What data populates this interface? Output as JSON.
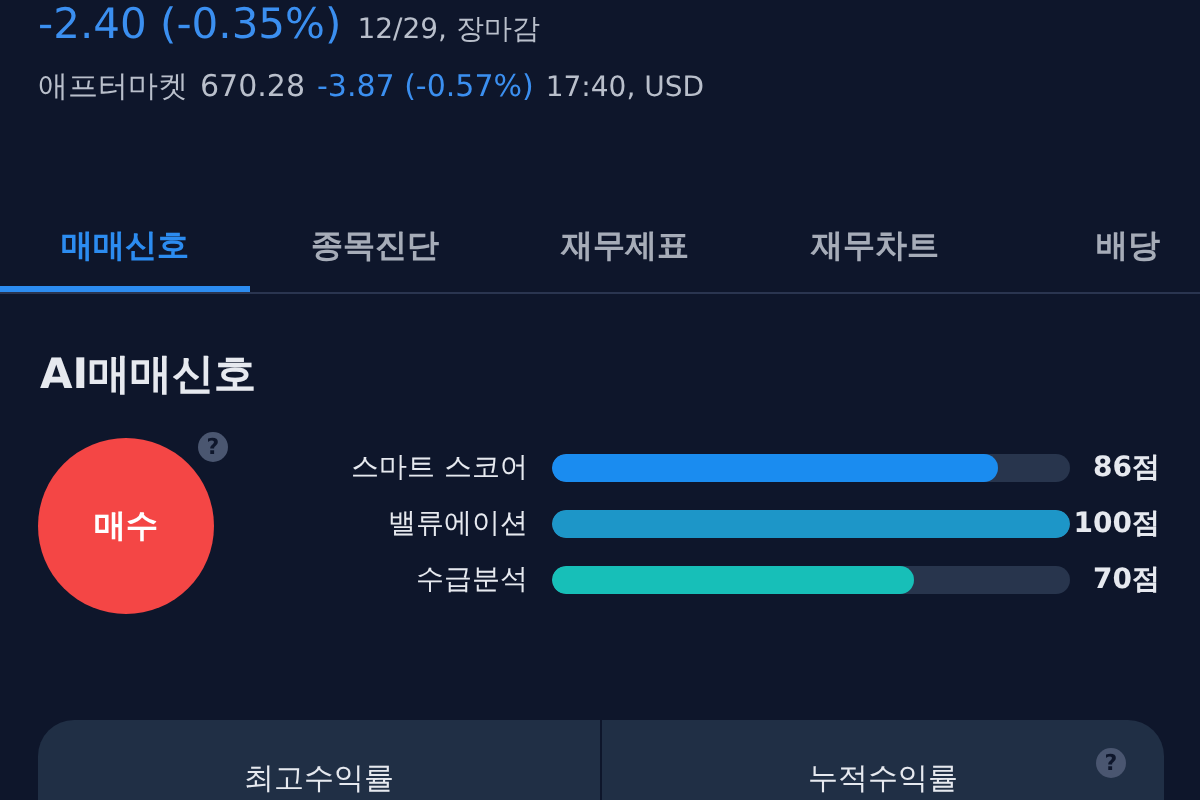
{
  "quote": {
    "change": "-2.40 (-0.35%)",
    "time": "12/29, 장마감"
  },
  "after_market": {
    "label": "애프터마켓",
    "price": "670.28",
    "change": "-3.87 (-0.57%)",
    "time": "17:40, USD"
  },
  "tabs": [
    {
      "label": "매매신호",
      "selected": true
    },
    {
      "label": "종목진단",
      "selected": false
    },
    {
      "label": "재무제표",
      "selected": false
    },
    {
      "label": "재무차트",
      "selected": false
    },
    {
      "label": "배당",
      "selected": false
    }
  ],
  "section_title": "AI매매신호",
  "signal": {
    "label": "매수",
    "help": "?"
  },
  "scores": [
    {
      "name": "스마트 스코어",
      "level": 0.86,
      "reading": "86점",
      "color": "#1a8cf0"
    },
    {
      "name": "밸류에이션",
      "level": 1.0,
      "reading": "100점",
      "color": "#1d96c8"
    },
    {
      "name": "수급분석",
      "level": 0.7,
      "reading": "70점",
      "color": "#17bfb8"
    }
  ],
  "returns_card": {
    "columns": [
      "최고수익률",
      "누적수익률"
    ],
    "help": "?"
  }
}
